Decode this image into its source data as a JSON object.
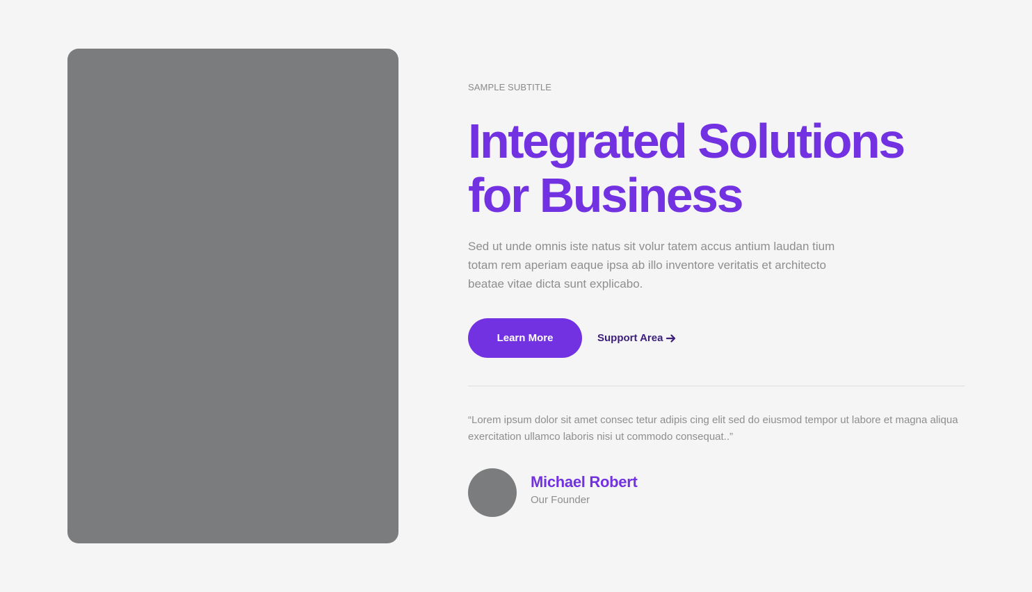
{
  "hero": {
    "subtitle": "SAMPLE SUBTITLE",
    "title_line1": "Integrated Solutions",
    "title_line2": "for Business",
    "description": "Sed ut unde omnis iste natus sit volur tatem accus antium laudan tium totam rem aperiam eaque ipsa ab illo inventore veritatis et architecto beatae vitae dicta sunt explicabo.",
    "primary_button": "Learn More",
    "secondary_link": "Support Area",
    "secondary_link_icon": "arrow-right-icon"
  },
  "testimonial": {
    "quote": "“Lorem ipsum dolor sit amet consec tetur adipis cing elit sed do eiusmod tempor ut labore et magna aliqua exercitation ullamco laboris nisi ut commodo consequat..”",
    "author_name": "Michael Robert",
    "author_role": "Our Founder"
  },
  "colors": {
    "accent": "#7232e1",
    "link": "#3b1f7a",
    "placeholder": "#7b7c7e",
    "background": "#f5f5f5",
    "muted_text": "#8e8e8e"
  }
}
